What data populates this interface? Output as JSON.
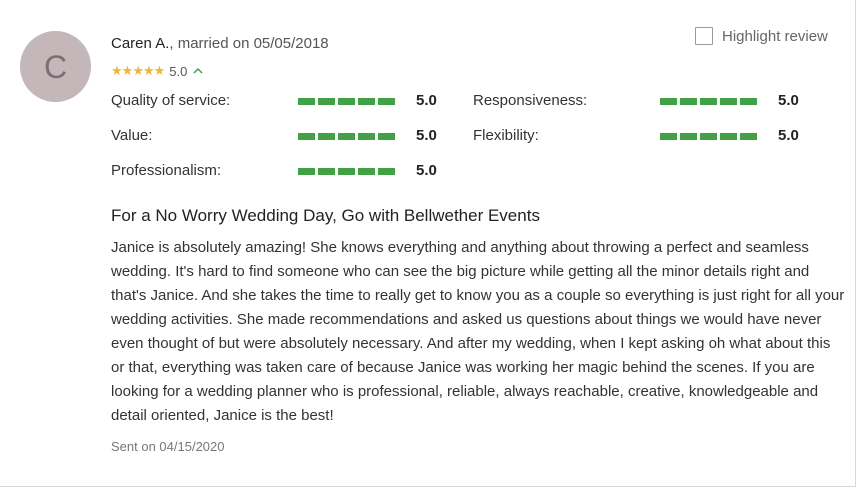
{
  "reviewer": {
    "avatar_initial": "C",
    "name": "Caren A.",
    "married_text": ", married on 05/05/2018"
  },
  "overall": {
    "stars": 5,
    "rating": "5.0",
    "expand_icon": "chevron-up-icon"
  },
  "highlight": {
    "label": "Highlight review",
    "checked": false
  },
  "ratings_left": [
    {
      "label": "Quality of service:",
      "value": "5.0"
    },
    {
      "label": "Value:",
      "value": "5.0"
    },
    {
      "label": "Professionalism:",
      "value": "5.0"
    }
  ],
  "ratings_right": [
    {
      "label": "Responsiveness:",
      "value": "5.0"
    },
    {
      "label": "Flexibility:",
      "value": "5.0"
    }
  ],
  "review": {
    "title": "For a No Worry Wedding Day, Go with Bellwether Events",
    "body": "Janice is absolutely amazing! She knows everything and anything about throwing a perfect and seamless wedding. It's hard to find someone who can see the big picture while getting all the minor details right and that's Janice. And she takes the time to really get to know you as a couple so everything is just right for all your wedding activities. She made recommendations and asked us questions about things we would have never even thought of but were absolutely necessary. And after my wedding, when I kept asking oh what about this or that, everything was taken care of because Janice was working her magic behind the scenes. If you are looking for a wedding planner who is professional, reliable, always reachable, creative, knowledgeable and detail oriented, Janice is the best!",
    "sent_text": "Sent on 04/15/2020"
  },
  "colors": {
    "star": "#e8b73c",
    "bar": "#43a047",
    "avatar_bg": "#c4b7ba"
  }
}
